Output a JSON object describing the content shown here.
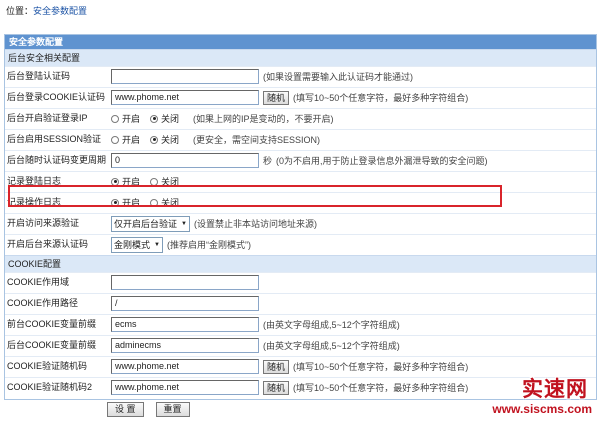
{
  "breadcrumb": {
    "prefix": "位置：",
    "current": "安全参数配置"
  },
  "panel": {
    "title": "安全参数配置"
  },
  "sections": {
    "backend": {
      "title": "后台安全相关配置"
    },
    "cookie": {
      "title": "COOKIE配置"
    }
  },
  "common": {
    "on_label": "开启",
    "off_label": "关闭",
    "random_button": "随机"
  },
  "rows": {
    "captcha": {
      "label": "后台登陆认证码",
      "value": "",
      "hint": "(如果设置需要输入此认证码才能通过)"
    },
    "cookie_code": {
      "label": "后台登录COOKIE认证码",
      "value": "www.phome.net",
      "hint": "(填写10~50个任意字符，最好多种字符组合)"
    },
    "ip_check": {
      "label": "后台开启验证登录IP",
      "selected": "off",
      "hint": "(如果上网的IP是变动的，不要开启)"
    },
    "session": {
      "label": "后台启用SESSION验证",
      "selected": "off",
      "hint": "(更安全，需空间支持SESSION)"
    },
    "code_change": {
      "label": "后台随时认证码变更周期",
      "value": "0",
      "unit": "秒",
      "hint": "(0为不启用,用于防止登录信息外漏泄导致的安全问题)"
    },
    "login_log": {
      "label": "记录登陆日志",
      "selected": "on"
    },
    "op_log": {
      "label": "记录操作日志",
      "selected": "on"
    },
    "source_check": {
      "label": "开启访问来源验证",
      "select_value": "仅开启后台验证",
      "hint": "(设置禁止非本站访问地址来源)"
    },
    "source_code": {
      "label": "开启后台来源认证码",
      "select_value": "金刚模式",
      "hint": "(推荐启用“金刚模式”)"
    },
    "cookie_domain": {
      "label": "COOKIE作用域",
      "value": ""
    },
    "cookie_path": {
      "label": "COOKIE作用路径",
      "value": "/"
    },
    "front_prefix": {
      "label": "前台COOKIE变量前缀",
      "value": "ecms",
      "hint": "(由英文字母组成,5~12个字符组成)"
    },
    "back_prefix": {
      "label": "后台COOKIE变量前缀",
      "value": "adminecms",
      "hint": "(由英文字母组成,5~12个字符组成)"
    },
    "cookie_rand": {
      "label": "COOKIE验证随机码",
      "value": "www.phome.net",
      "hint": "(填写10~50个任意字符，最好多种字符组合)"
    },
    "cookie_rand2": {
      "label": "COOKIE验证随机码2",
      "value": "www.phome.net",
      "hint": "(填写10~50个任意字符，最好多种字符组合)"
    }
  },
  "buttons": {
    "submit": "设 置",
    "reset": "重置"
  },
  "watermark": {
    "name": "实速网",
    "url": "www.siscms.com"
  },
  "colors": {
    "highlight": "#d9242b",
    "title_bar": "#5f93d0",
    "section_bar": "#dbe8f7",
    "watermark": "#c1121f"
  }
}
